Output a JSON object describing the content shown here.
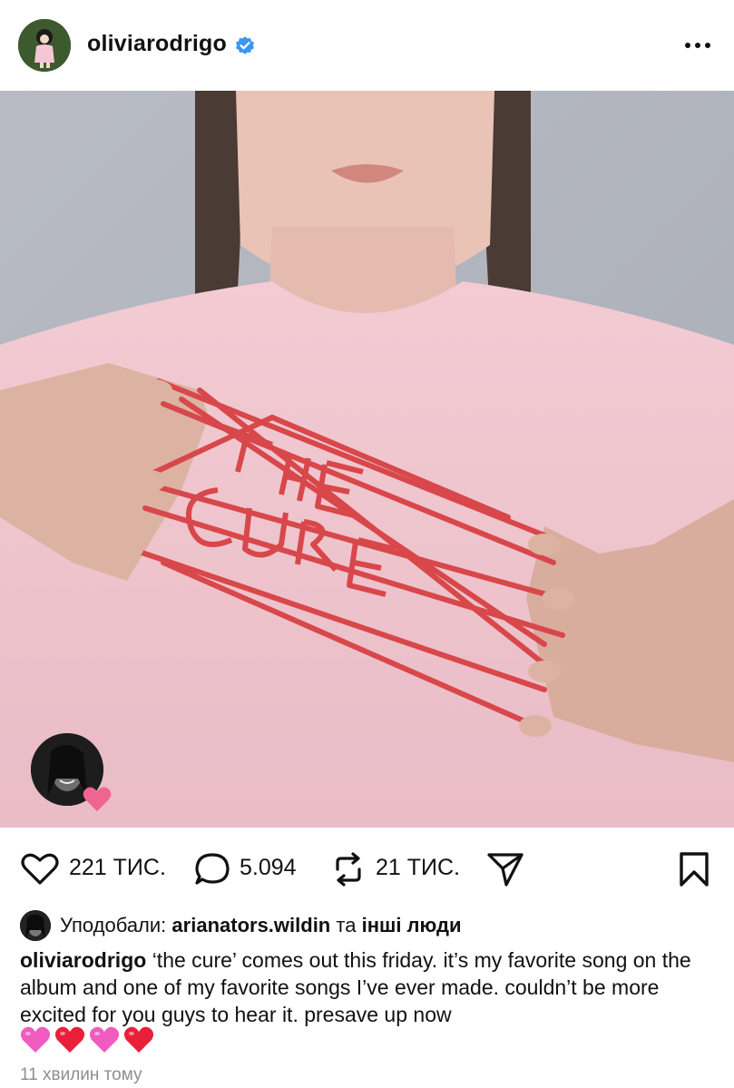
{
  "post": {
    "username": "oliviarodrigo",
    "verified_icon": "verified-badge-icon",
    "more_icon": "more-options-icon",
    "image_alt": "photo of person holding red string spelling 'the cure'",
    "tag_avatar_icon": "tagged-user-avatar",
    "tag_heart_icon": "heart-emoji-icon"
  },
  "actions": {
    "like_icon": "heart-outline-icon",
    "likes": "221 ТИС.",
    "comment_icon": "comment-icon",
    "comments": "5.094",
    "repost_icon": "repost-icon",
    "reposts": "21 ТИС.",
    "share_icon": "share-icon",
    "save_icon": "bookmark-icon"
  },
  "liked_by": {
    "prefix": "Уподобали:",
    "user": "arianators.wildin",
    "connector": "та",
    "others": "інші люди"
  },
  "caption": {
    "author": "oliviarodrigo",
    "text": "‘the cure’ comes out this friday. it’s my favorite song on the album and one of my favorite songs I’ve ever made. couldn’t be more excited for you guys to hear it. presave up now",
    "emojis": [
      "pink-heart",
      "red-heart",
      "pink-heart",
      "red-heart"
    ]
  },
  "timestamp": "11 хвилин тому",
  "colors": {
    "verified": "#3897f0",
    "pink_heart": "#f05bbf",
    "red_heart": "#e8203a",
    "timestamp": "#8e8e8e"
  }
}
